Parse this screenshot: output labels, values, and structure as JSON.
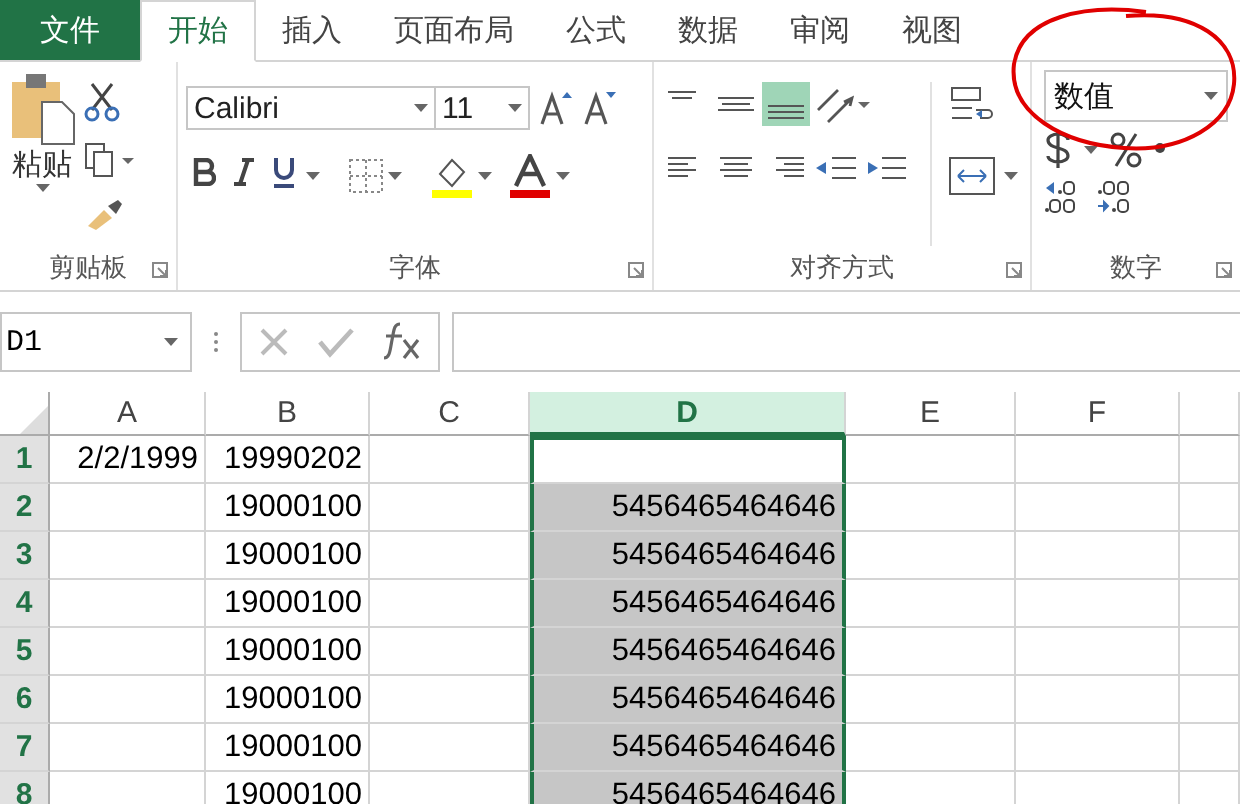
{
  "tabs": [
    {
      "label": "文件",
      "kind": "file",
      "selected": false
    },
    {
      "label": "开始",
      "kind": "tab",
      "selected": true
    },
    {
      "label": "插入",
      "kind": "tab",
      "selected": false
    },
    {
      "label": "页面布局",
      "kind": "tab",
      "selected": false
    },
    {
      "label": "公式",
      "kind": "tab",
      "selected": false
    },
    {
      "label": "数据",
      "kind": "tab",
      "selected": false
    },
    {
      "label": "审阅",
      "kind": "tab",
      "selected": false
    },
    {
      "label": "视图",
      "kind": "tab",
      "selected": false
    }
  ],
  "ribbon": {
    "clipboard": {
      "paste_label": "粘贴",
      "group_label": "剪贴板"
    },
    "font": {
      "name": "Calibri",
      "size": "11",
      "group_label": "字体"
    },
    "alignment": {
      "group_label": "对齐方式"
    },
    "number": {
      "format": "数值",
      "group_label": "数字"
    }
  },
  "formula_bar": {
    "name_box": "D1"
  },
  "sheet": {
    "columns": [
      {
        "label": "A",
        "selected": false
      },
      {
        "label": "B",
        "selected": false
      },
      {
        "label": "C",
        "selected": false
      },
      {
        "label": "D",
        "selected": true
      },
      {
        "label": "E",
        "selected": false
      },
      {
        "label": "F",
        "selected": false
      }
    ],
    "rows": [
      {
        "label": "1",
        "selected": true,
        "active": true,
        "a": "2/2/1999",
        "b": "19990202"
      },
      {
        "label": "2",
        "selected": true,
        "active": false,
        "b": "19000100",
        "d": "5456465464646"
      },
      {
        "label": "3",
        "selected": true,
        "active": false,
        "b": "19000100",
        "d": "5456465464646"
      },
      {
        "label": "4",
        "selected": true,
        "active": false,
        "b": "19000100",
        "d": "5456465464646"
      },
      {
        "label": "5",
        "selected": true,
        "active": false,
        "b": "19000100",
        "d": "5456465464646"
      },
      {
        "label": "6",
        "selected": true,
        "active": false,
        "b": "19000100",
        "d": "5456465464646"
      },
      {
        "label": "7",
        "selected": true,
        "active": false,
        "b": "19000100",
        "d": "5456465464646"
      },
      {
        "label": "8",
        "selected": true,
        "active": false,
        "b": "19000100",
        "d": "5456465464646"
      }
    ]
  }
}
